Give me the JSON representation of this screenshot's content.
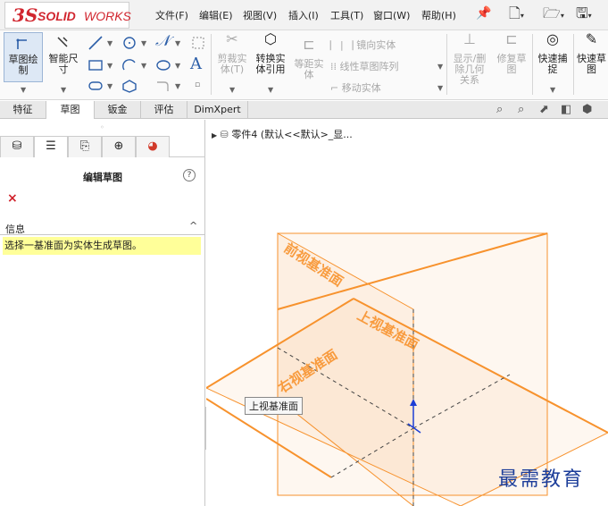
{
  "app": {
    "logo_ds": "3S",
    "logo_solid": "SOLID",
    "logo_works": "WORKS",
    "brand_color": "#d1262f"
  },
  "menu": [
    {
      "label": "文件(F)"
    },
    {
      "label": "编辑(E)"
    },
    {
      "label": "视图(V)"
    },
    {
      "label": "插入(I)"
    },
    {
      "label": "工具(T)"
    },
    {
      "label": "窗口(W)"
    },
    {
      "label": "帮助(H)"
    }
  ],
  "ribbon": {
    "sketch_label": "草图绘\n制",
    "smart_dim_label": "智能尺\n寸",
    "trim_label": "剪裁实\n体(T)",
    "convert_label": "转换实\n体引用",
    "offset_label": "等距实\n体",
    "mirror_label": "镜向实体",
    "linear_pattern_label": "线性草图阵列",
    "move_label": "移动实体",
    "show_relations_label": "显示/删\n除几何\n关系",
    "repair_label": "修复草\n图",
    "quick_snap_label": "快速捕\n捉",
    "rapid_sketch_label": "快速草\n图"
  },
  "tabs": [
    {
      "label": "特征"
    },
    {
      "label": "草图"
    },
    {
      "label": "钣金"
    },
    {
      "label": "评估"
    },
    {
      "label": "DimXpert"
    }
  ],
  "property_manager": {
    "title": "编辑草图",
    "help": "?",
    "cancel": "×",
    "info_header": "信息",
    "info_caret": "^",
    "info_message": "选择一基准面为实体生成草图。"
  },
  "viewport": {
    "tree_node": "零件4  (默认<<默认>_显...",
    "tooltip": "上视基准面",
    "plane_front": "前视基准面",
    "plane_top": "上视基准面",
    "plane_right": "右视基准面",
    "plane_color": "#f7922d",
    "watermark": "最需教育"
  }
}
